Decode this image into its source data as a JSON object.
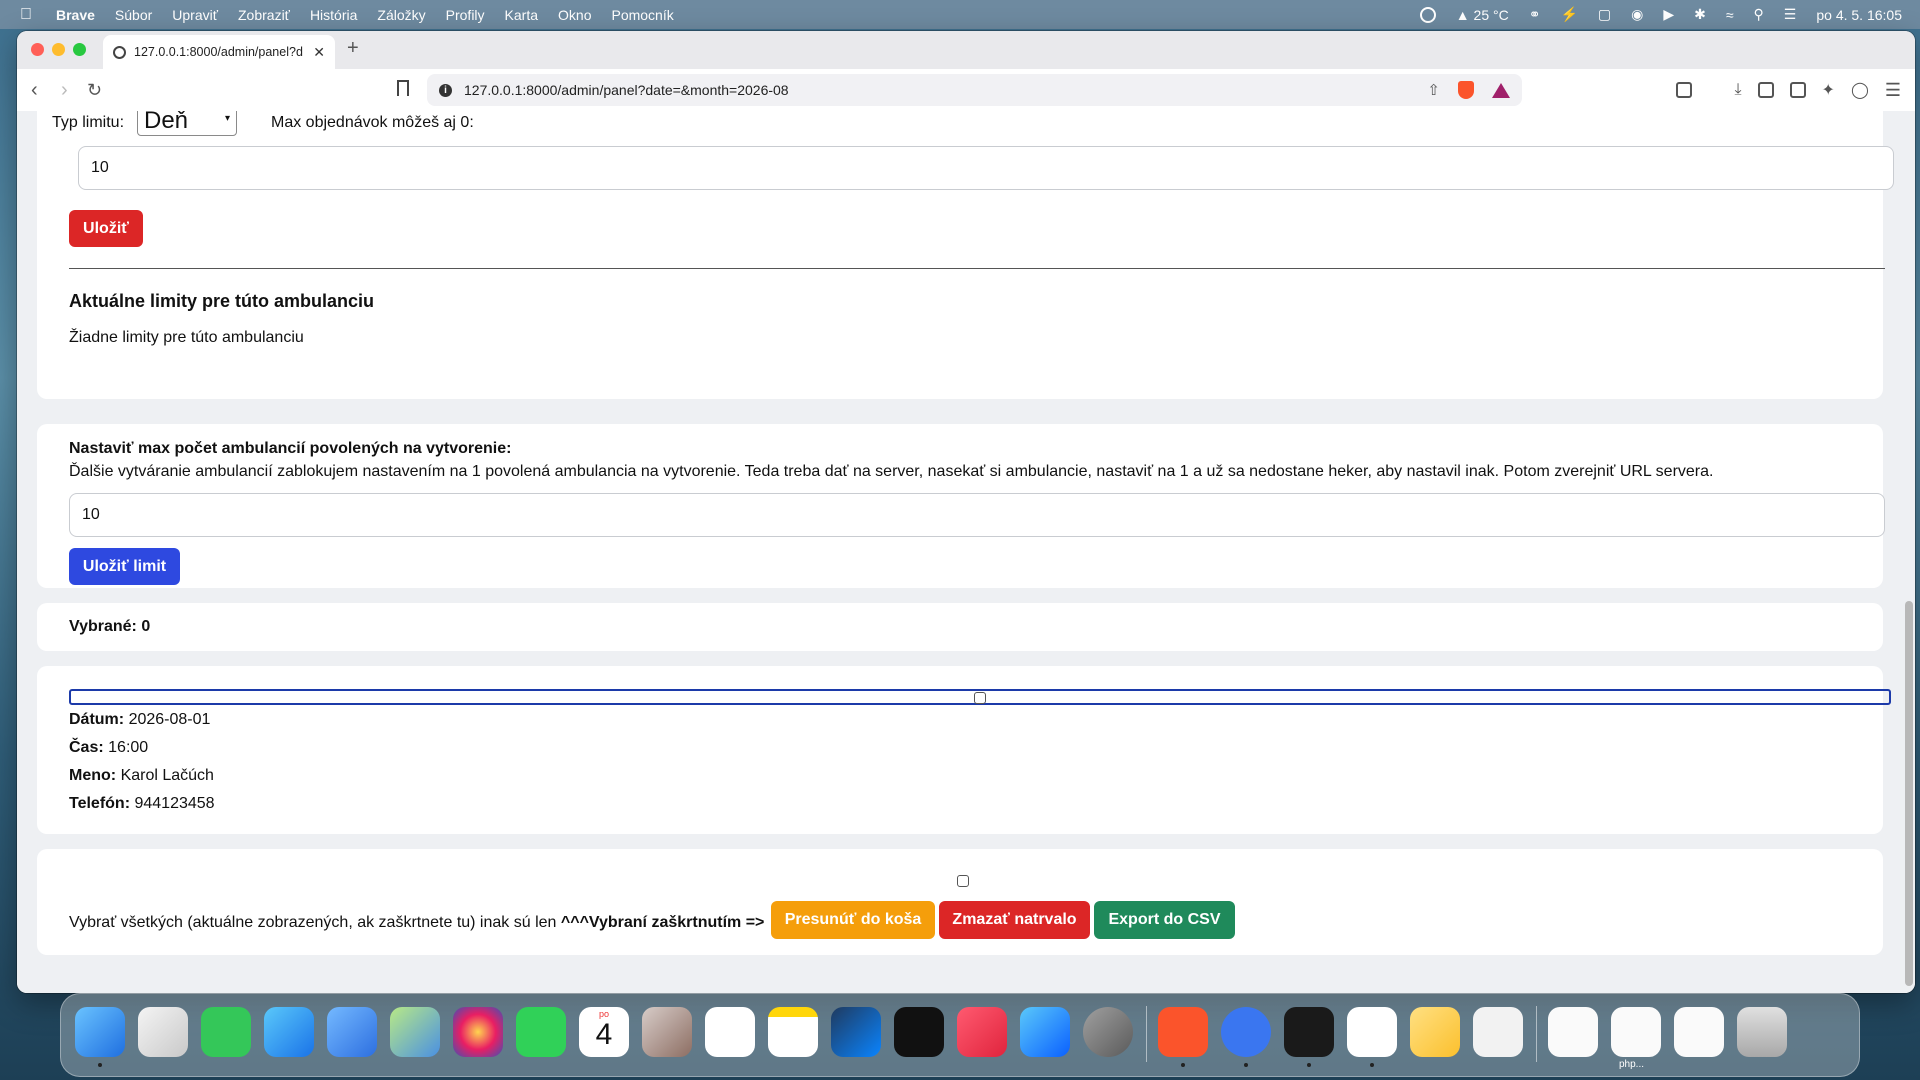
{
  "menubar": {
    "app": "Brave",
    "items": [
      "Súbor",
      "Upraviť",
      "Zobraziť",
      "História",
      "Záložky",
      "Profily",
      "Karta",
      "Okno",
      "Pomocník"
    ],
    "weather": "25 °C",
    "datetime": "po 4. 5.  16:05"
  },
  "browser": {
    "tab_title": "127.0.0.1:8000/admin/panel?d",
    "url": "127.0.0.1:8000/admin/panel?date=&month=2026-08"
  },
  "limit_form": {
    "type_label": "Typ limitu:",
    "type_value": "Deň",
    "max_label": "Max objednávok môžeš aj 0:",
    "max_value": "10",
    "save_label": "Uložiť"
  },
  "current_limits": {
    "heading": "Aktuálne limity pre túto ambulanciu",
    "empty_text": "Žiadne limity pre túto ambulanciu"
  },
  "ambulance_limit": {
    "heading": "Nastaviť max počet ambulancií povolených na vytvorenie:",
    "description": "Ďalšie vytváranie ambulancií zablokujem nastavením na 1 povolená ambulancia na vytvorenie. Teda treba dať na server, nasekať si ambulancie, nastaviť na 1 a už sa nedostane heker, aby nastavil inak. Potom zverejniť URL servera.",
    "value": "10",
    "save_label": "Uložiť limit"
  },
  "selected": {
    "text": "Vybrané: 0"
  },
  "booking": {
    "date_label": "Dátum:",
    "date": "2026-08-01",
    "time_label": "Čas:",
    "time": "16:00",
    "name_label": "Meno:",
    "name": "Karol Lačúch",
    "phone_label": "Telefón:",
    "phone": "944123458"
  },
  "bulk": {
    "text": "Vybrať všetkých (aktuálne zobrazených, ak zaškrtnete tu) inak sú len",
    "text_bold": "^^^Vybraní zaškrtnutím =>",
    "trash_label": "Presunúť do koša",
    "delete_label": "Zmazať natrvalo",
    "export_label": "Export do CSV"
  },
  "dock": {
    "calendar_month": "po",
    "calendar_day": "4",
    "php_label": "php..."
  },
  "colors": {
    "save_red": "#dc2626",
    "save_limit_blue": "#2e49e0",
    "trash_orange": "#f59e0b",
    "delete_red": "#dc2626",
    "export_green": "#1f8a5b"
  }
}
